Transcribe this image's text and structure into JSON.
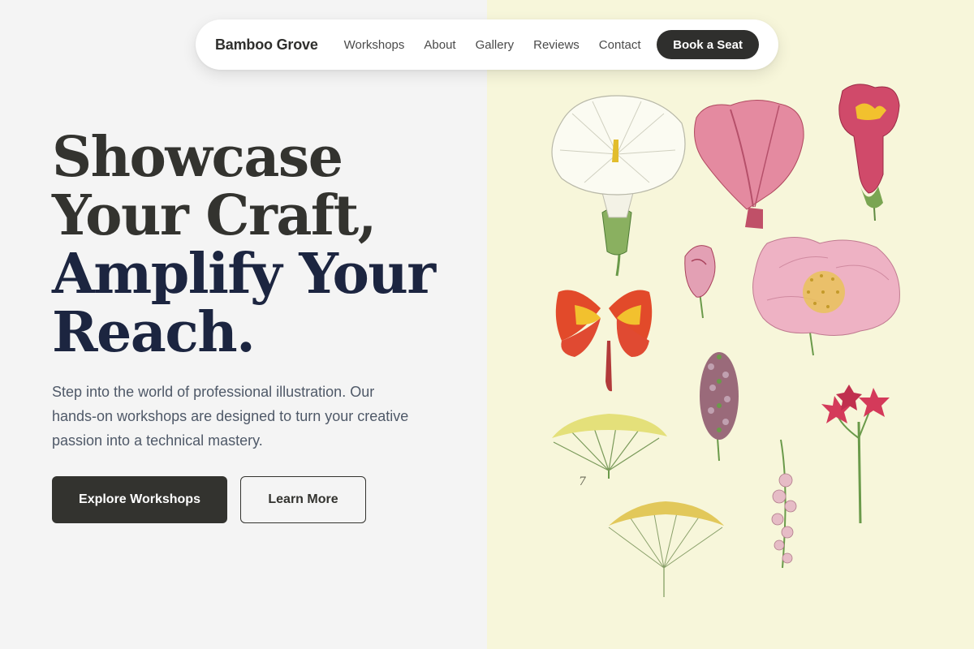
{
  "nav": {
    "brand": "Bamboo Grove",
    "links": [
      "Workshops",
      "About",
      "Gallery",
      "Reviews",
      "Contact"
    ],
    "cta": "Book a Seat"
  },
  "hero": {
    "title_lines": [
      "Showcase",
      "Your Craft,",
      "Amplify Your",
      "Reach."
    ],
    "description": "Step into the world of professional illustration. Our hands-on workshops are designed to turn your creative passion into a technical mastery.",
    "primary_button": "Explore Workshops",
    "secondary_button": "Learn More"
  },
  "illustration": {
    "plate_number": "7",
    "colors": {
      "background": "#f7f6da",
      "petal_pink": "#e8a6b8",
      "petal_red": "#c8486a",
      "petal_orange": "#e24a2a",
      "petal_yellow": "#f2c12e",
      "leaf_green": "#6a9a4a"
    }
  },
  "colors": {
    "left_background": "#f4f4f4",
    "dark_text": "#33332f",
    "navy_text": "#1c2540",
    "body_text": "#4f5968"
  }
}
